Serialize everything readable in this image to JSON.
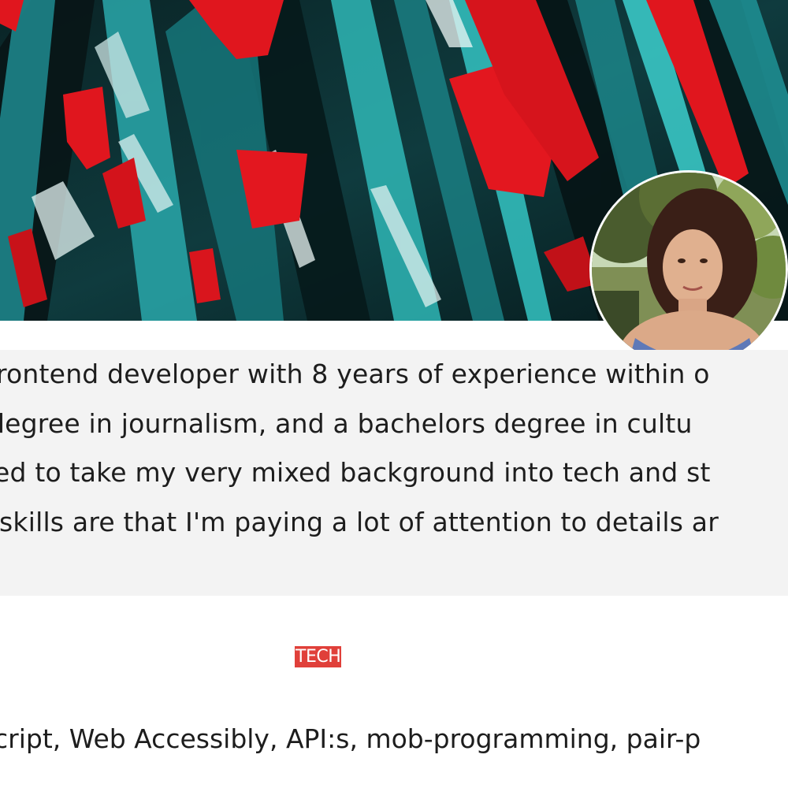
{
  "hero": {
    "image": "abstract-paint-banner",
    "colors": {
      "base": "#0d1a1c",
      "teal": "#1e8a8f",
      "cyan": "#3fd0cf",
      "red": "#e0161e",
      "white": "#e9f4f3"
    }
  },
  "profile": {
    "avatar": "profile-photo"
  },
  "about": {
    "lines": [
      "rontend developer with 8 years of experience within o",
      " degree in journalism, and a bachelors degree in cultu",
      "ed to take my very mixed background into tech and st",
      "skills are that I'm paying a lot of attention to details ar"
    ]
  },
  "tech": {
    "heading": "TECH",
    "list": "cript, Web Accessibly, API:s, mob-programming, pair-p"
  },
  "colors": {
    "accent": "#e0403a",
    "panel": "#f3f3f3",
    "text": "#1d1d1d"
  }
}
